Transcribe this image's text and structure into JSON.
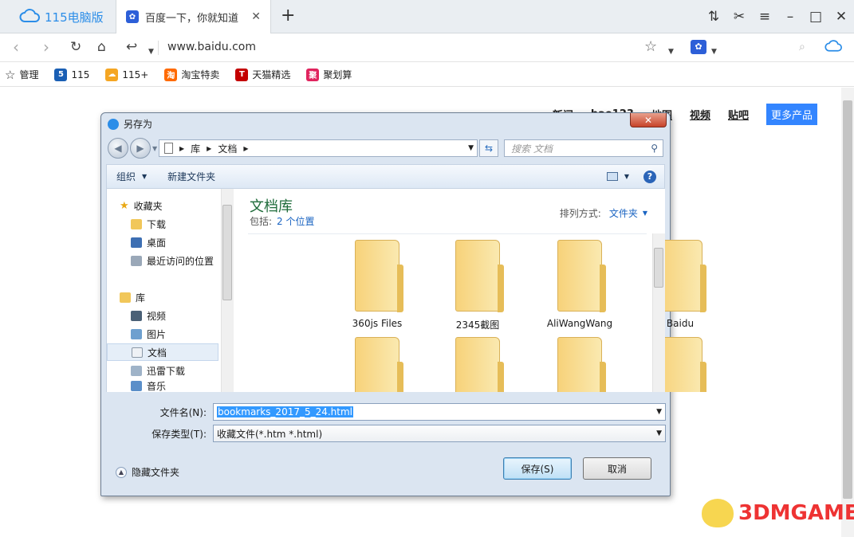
{
  "browser": {
    "brand": "115电脑版",
    "tab_title": "百度一下，你就知道",
    "url": "www.baidu.com",
    "bookmarks": [
      {
        "label": "管理",
        "icon": "star-icon",
        "color": "#333333"
      },
      {
        "label": "115",
        "icon": "115-icon",
        "color": "#1a5fb4"
      },
      {
        "label": "115+",
        "icon": "cloud-orange-icon",
        "color": "#f5a623"
      },
      {
        "label": "淘宝特卖",
        "icon": "taobao-icon",
        "color": "#ff6a00"
      },
      {
        "label": "天猫精选",
        "icon": "tmall-icon",
        "color": "#c40000"
      },
      {
        "label": "聚划算",
        "icon": "juhuasuan-icon",
        "color": "#e0245e"
      }
    ]
  },
  "page": {
    "nav_links": [
      "新闻",
      "hao123",
      "地图",
      "视频",
      "贴吧"
    ],
    "more_products": "更多产品",
    "watermark": "3DMGAME"
  },
  "dialog": {
    "title": "另存为",
    "breadcrumb": [
      "库",
      "文档"
    ],
    "search_placeholder": "搜索 文档",
    "toolbar": {
      "organize": "组织",
      "new_folder": "新建文件夹"
    },
    "nav": {
      "favorites": "收藏夹",
      "downloads": "下载",
      "desktop": "桌面",
      "recent": "最近访问的位置",
      "libraries": "库",
      "videos": "视频",
      "pictures": "图片",
      "documents": "文档",
      "xunlei": "迅雷下载",
      "music": "音乐"
    },
    "library_title": "文档库",
    "includes_label": "包括:",
    "includes_value": "2 个位置",
    "sort_label": "排列方式:",
    "sort_value": "文件夹",
    "folders": [
      "360js Files",
      "2345截图",
      "AliWangWang",
      "Baidu",
      "",
      "",
      "",
      ""
    ],
    "filename_label": "文件名(N):",
    "filename_value": "bookmarks_2017_5_24.html",
    "filetype_label": "保存类型(T):",
    "filetype_value": "收藏文件(*.htm *.html)",
    "hide_folders": "隐藏文件夹",
    "save_button": "保存(S)",
    "cancel_button": "取消"
  }
}
